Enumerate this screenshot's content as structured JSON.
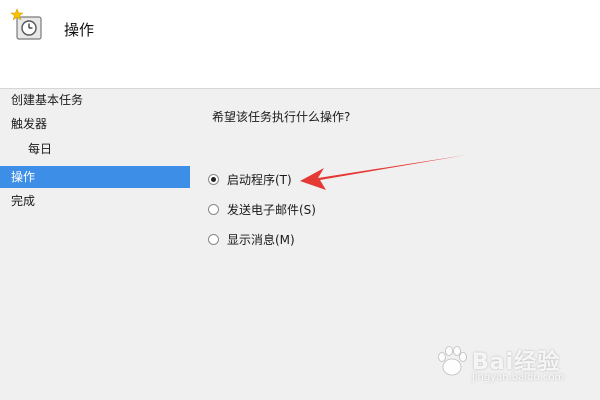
{
  "header": {
    "title": "操作",
    "icon": "task-clock-icon"
  },
  "sidebar": {
    "items": [
      {
        "label": "创建基本任务"
      },
      {
        "label": "触发器"
      },
      {
        "label": "每日"
      },
      {
        "label": "操作",
        "selected": true
      },
      {
        "label": "完成"
      }
    ]
  },
  "main": {
    "question": "希望该任务执行什么操作?",
    "options": [
      {
        "label": "启动程序(T)",
        "checked": true
      },
      {
        "label": "发送电子邮件(S)",
        "checked": false
      },
      {
        "label": "显示消息(M)",
        "checked": false
      }
    ]
  },
  "annotation": {
    "arrow_color": "#e53935"
  },
  "watermark": {
    "text": "Bai经验",
    "sub": "jingyan.baidu.com"
  },
  "colors": {
    "selected_bg": "#3d8ee6",
    "header_bg": "#ffffff",
    "panel_bg": "#f0f0f0"
  }
}
